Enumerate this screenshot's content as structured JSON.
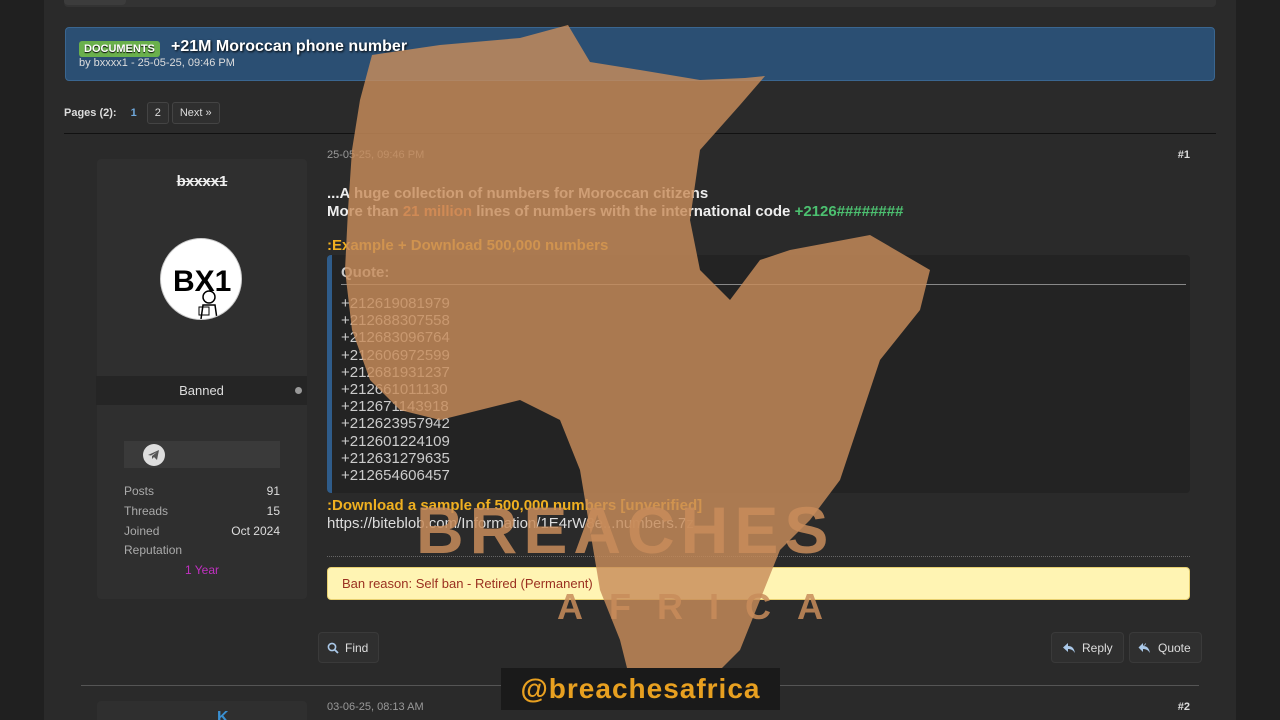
{
  "thread": {
    "badge": "DOCUMENTS",
    "title": "+21M Moroccan phone number",
    "meta": "by bxxxx1 - 25-05-25, 09:46 PM"
  },
  "pagination": {
    "label": "Pages (2):",
    "current": "1",
    "page2": "2",
    "next": "Next »"
  },
  "user": {
    "name": "bxxxx1",
    "avatar_text": "BX1",
    "title": "Banned",
    "contact_icon": "telegram-icon",
    "posts_label": "Posts",
    "posts": "91",
    "threads_label": "Threads",
    "threads": "15",
    "joined_label": "Joined",
    "joined": "Oct 2024",
    "reputation_label": "Reputation",
    "reputation_extra": "1 Year"
  },
  "post1": {
    "date": "25-05-25, 09:46 PM",
    "number": "#1",
    "intro": "...A huge collection of numbers for Moroccan citizens",
    "line2_a": "More than ",
    "line2_highlight": "21 million",
    "line2_b": " lines of numbers with the international code ",
    "line2_code": "+2126########",
    "example": ":Example + Download 500,000 numbers",
    "quote_title": "Quote:",
    "numbers": [
      "+212619081979",
      "+212688307558",
      "+212683096764",
      "+212606972599",
      "+212681931237",
      "+212661011130",
      "+212671143918",
      "+212623957942",
      "+212601224109",
      "+212631279635",
      "+212654606457"
    ],
    "download_line": ":Download a sample of 500,000 numbers [unverified]",
    "url": "https://biteblob.com/Information/1E4rW8e...numbers.7z",
    "ban_reason": "Ban reason: Self ban - Retired (Permanent)"
  },
  "actions": {
    "find": "Find",
    "reply": "Reply",
    "quote": "Quote"
  },
  "post2": {
    "date": "03-06-25, 08:13 AM",
    "number": "#2",
    "user_fragment": "K"
  },
  "watermark": {
    "big": "BREACHES",
    "small": "AFRICA",
    "handle": "@breachesafrica"
  }
}
